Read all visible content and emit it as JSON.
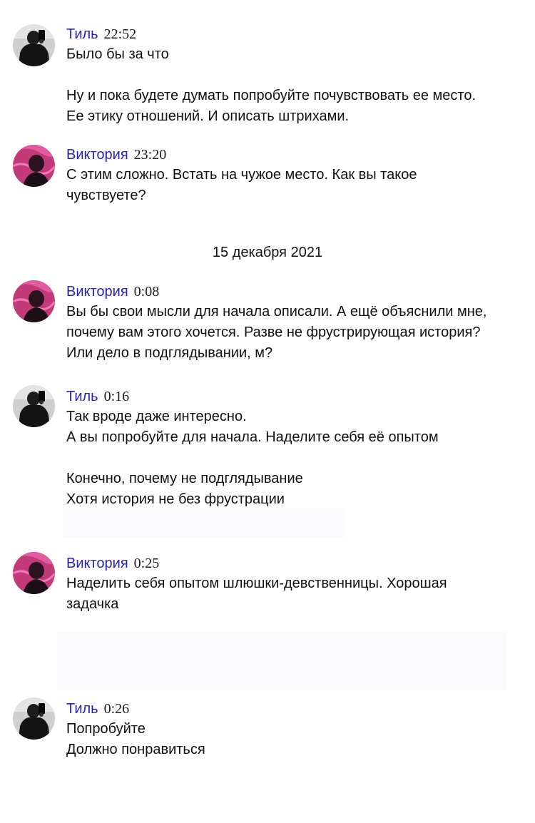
{
  "messages": [
    {
      "author": "Тиль",
      "time": "22:52",
      "avatar": "til-avatar",
      "lines": [
        "Было бы за что",
        "",
        "Ну и пока будете думать попробуйте почувствовать ее место.",
        "Ее этику отношений. И описать штрихами."
      ]
    },
    {
      "author": "Виктория",
      "time": "23:20",
      "avatar": "viktoria-avatar",
      "lines": [
        "С этим сложно. Встать на чужое место. Как вы такое",
        "чувствуете?"
      ]
    },
    {
      "author": "Виктория",
      "time": "0:08",
      "avatar": "viktoria-avatar",
      "lines": [
        "Вы бы свои мысли для начала описали. А ещё объяснили мне,",
        "почему вам этого хочется. Разве не фрустрирующая история?",
        "Или дело в подглядывании, м?"
      ]
    },
    {
      "author": "Тиль",
      "time": "0:16",
      "avatar": "til-avatar",
      "lines": [
        "Так вроде даже интересно.",
        "А вы попробуйте для начала. Наделите себя её опытом",
        "",
        "Конечно, почему не подглядывание",
        "Хотя история не без фрустрации"
      ]
    },
    {
      "author": "Виктория",
      "time": "0:25",
      "avatar": "viktoria-avatar",
      "lines": [
        "Наделить себя опытом шлюшки-девственницы. Хорошая",
        "задачка"
      ]
    },
    {
      "author": "Тиль",
      "time": "0:26",
      "avatar": "til-avatar",
      "lines": [
        "Попробуйте",
        "Должно понравиться"
      ]
    }
  ],
  "date_separator": "15 декабря 2021",
  "colors": {
    "author_link": "#2323b8",
    "text": "#111111",
    "background": "#ffffff"
  }
}
